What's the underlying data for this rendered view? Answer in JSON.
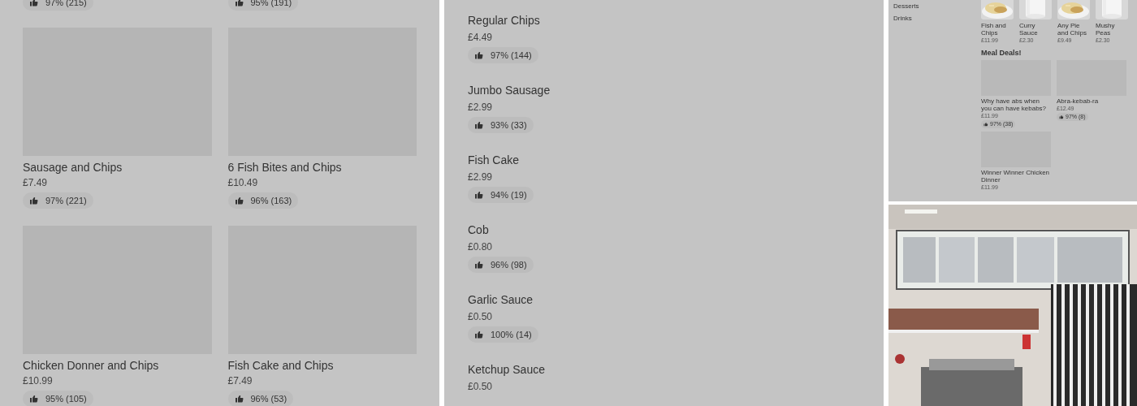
{
  "grid_menu": {
    "top_ratings": [
      "97% (215)",
      "95% (191)"
    ],
    "items": [
      {
        "name": "Sausage and Chips",
        "price": "£7.49",
        "rating": "97% (221)"
      },
      {
        "name": "6 Fish Bites and Chips",
        "price": "£10.49",
        "rating": "96% (163)"
      },
      {
        "name": "Chicken Donner and Chips",
        "price": "£10.99",
        "rating": "95% (105)"
      },
      {
        "name": "Fish Cake and Chips",
        "price": "£7.49",
        "rating": "96% (53)"
      }
    ]
  },
  "list_menu": {
    "items": [
      {
        "name": "Regular Chips",
        "price": "£4.49",
        "rating": "97% (144)"
      },
      {
        "name": "Jumbo Sausage",
        "price": "£2.99",
        "rating": "93% (33)"
      },
      {
        "name": "Fish Cake",
        "price": "£2.99",
        "rating": "94% (19)"
      },
      {
        "name": "Cob",
        "price": "£0.80",
        "rating": "96% (98)"
      },
      {
        "name": "Garlic Sauce",
        "price": "£0.50",
        "rating": "100% (14)"
      },
      {
        "name": "Ketchup Sauce",
        "price": "£0.50"
      }
    ]
  },
  "store_page": {
    "categories": [
      "Desserts",
      "Drinks"
    ],
    "top_items": [
      {
        "name": "Fish and Chips",
        "price": "£11.99"
      },
      {
        "name": "Curry Sauce",
        "price": "£2.30"
      },
      {
        "name": "Any Pie and Chips",
        "price": "£9.49"
      },
      {
        "name": "Mushy Peas",
        "price": "£2.30"
      }
    ],
    "section_title": "Meal Deals!",
    "deals": [
      {
        "name": "Why have abs when you can have kebabs?",
        "price": "£11.99",
        "rating": "97% (38)"
      },
      {
        "name": "Abra-kebab-ra",
        "price": "£12.49",
        "rating": "97% (8)"
      },
      {
        "name": "Winner Winner Chicken Dinner",
        "price": "£11.99"
      }
    ]
  }
}
